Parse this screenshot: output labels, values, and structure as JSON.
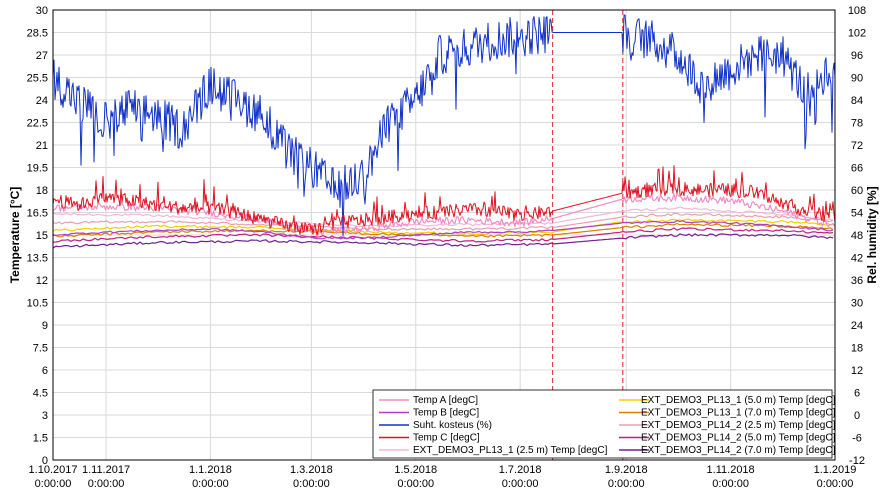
{
  "chart_data": {
    "type": "line",
    "ylabel": "Temperature [°C]",
    "y2label": "Rel. humidity [%]",
    "ylim": [
      0,
      30
    ],
    "y2lim": [
      -12,
      108
    ],
    "xlim": [
      "2017-10-01",
      "2019-01-01"
    ],
    "grid": true,
    "legend_position": "bottom-right",
    "y_ticks": [
      "0",
      "1.5",
      "3",
      "4.5",
      "6",
      "7.5",
      "9",
      "10.5",
      "12",
      "13.5",
      "15",
      "16.5",
      "18",
      "19.5",
      "21",
      "22.5",
      "24",
      "25.5",
      "27",
      "28.5",
      "30"
    ],
    "y2_ticks": [
      "-12",
      "-6",
      "0",
      "6",
      "12",
      "18",
      "24",
      "30",
      "36",
      "42",
      "48",
      "54",
      "60",
      "66",
      "72",
      "78",
      "84",
      "90",
      "96",
      "102",
      "108"
    ],
    "x_ticks": [
      {
        "date": "1.10.2017",
        "time": "0:00:00"
      },
      {
        "date": "1.11.2017",
        "time": "0:00:00"
      },
      {
        "date": "1.1.2018",
        "time": "0:00:00"
      },
      {
        "date": "1.3.2018",
        "time": "0:00:00"
      },
      {
        "date": "1.5.2018",
        "time": "0:00:00"
      },
      {
        "date": "1.7.2018",
        "time": "0:00:00"
      },
      {
        "date": "1.9.2018",
        "time": "0:00:00"
      },
      {
        "date": "1.11.2018",
        "time": "0:00:00"
      },
      {
        "date": "1.1.2019",
        "time": "0:00:00"
      }
    ],
    "markers": [
      "2018-07-20",
      "2018-08-30"
    ],
    "series": [
      {
        "name": "Temp A [degC]",
        "axis": "left",
        "color": "#f08cc4",
        "x": [
          "2017-10-01",
          "2017-11-01",
          "2017-12-01",
          "2018-01-01",
          "2018-02-01",
          "2018-03-01",
          "2018-04-01",
          "2018-05-01",
          "2018-06-01",
          "2018-07-01",
          "2018-07-20",
          "2018-08-30",
          "2018-10-01",
          "2018-11-01",
          "2018-12-01",
          "2019-01-01"
        ],
        "y": [
          16.8,
          16.9,
          16.8,
          16.5,
          16.0,
          15.2,
          15.4,
          15.9,
          16.0,
          15.8,
          16.1,
          17.4,
          17.5,
          17.3,
          16.6,
          15.6
        ]
      },
      {
        "name": "Temp B [degC]",
        "axis": "left",
        "color": "#b040c0",
        "x": [
          "2017-10-01",
          "2017-11-01",
          "2017-12-01",
          "2018-01-01",
          "2018-02-01",
          "2018-03-01",
          "2018-04-01",
          "2018-05-01",
          "2018-06-01",
          "2018-07-01",
          "2018-07-20",
          "2018-08-30",
          "2018-10-01",
          "2018-11-01",
          "2018-12-01",
          "2019-01-01"
        ],
        "y": [
          15.0,
          15.2,
          15.3,
          15.4,
          15.2,
          14.8,
          14.8,
          15.0,
          15.2,
          15.2,
          15.3,
          15.8,
          15.9,
          15.8,
          15.6,
          15.3
        ]
      },
      {
        "name": "Suht. kosteus (%)",
        "axis": "right",
        "color": "#1030c8",
        "x": [
          "2017-10-01",
          "2017-10-15",
          "2017-11-01",
          "2017-11-15",
          "2017-12-01",
          "2017-12-15",
          "2018-01-01",
          "2018-01-15",
          "2018-02-01",
          "2018-02-15",
          "2018-03-01",
          "2018-03-15",
          "2018-04-01",
          "2018-04-15",
          "2018-05-01",
          "2018-05-15",
          "2018-06-01",
          "2018-06-15",
          "2018-07-01",
          "2018-07-20",
          "2018-08-30",
          "2018-09-15",
          "2018-10-01",
          "2018-10-15",
          "2018-11-01",
          "2018-11-15",
          "2018-12-01",
          "2018-12-15",
          "2019-01-01"
        ],
        "y": [
          90,
          84,
          78,
          82,
          80,
          76,
          88,
          84,
          80,
          70,
          66,
          60,
          64,
          78,
          84,
          96,
          98,
          100,
          101,
          102,
          102,
          100,
          96,
          88,
          92,
          96,
          96,
          86,
          94
        ]
      },
      {
        "name": "Temp C [degC]",
        "axis": "left",
        "color": "#e01020",
        "x": [
          "2017-10-01",
          "2017-10-15",
          "2017-11-01",
          "2017-11-15",
          "2017-12-01",
          "2017-12-15",
          "2018-01-01",
          "2018-01-15",
          "2018-02-01",
          "2018-02-15",
          "2018-03-01",
          "2018-03-15",
          "2018-04-01",
          "2018-04-15",
          "2018-05-01",
          "2018-05-15",
          "2018-06-01",
          "2018-06-15",
          "2018-07-01",
          "2018-07-20",
          "2018-08-30",
          "2018-09-15",
          "2018-10-01",
          "2018-10-15",
          "2018-11-01",
          "2018-11-15",
          "2018-12-01",
          "2018-12-15",
          "2019-01-01"
        ],
        "y": [
          17.4,
          17.0,
          17.5,
          17.3,
          17.0,
          16.8,
          16.8,
          16.5,
          16.0,
          15.6,
          15.3,
          15.8,
          16.0,
          16.2,
          16.4,
          16.5,
          16.7,
          16.6,
          16.3,
          16.6,
          17.8,
          18.0,
          18.1,
          18.0,
          18.0,
          17.8,
          17.2,
          16.6,
          16.2
        ]
      },
      {
        "name": "EXT_DEMO3_PL13_1 (2.5 m) Temp [degC]",
        "axis": "left",
        "color": "#f0b8d8",
        "x": [
          "2017-10-01",
          "2017-12-01",
          "2018-02-01",
          "2018-04-01",
          "2018-06-01",
          "2018-07-20",
          "2018-08-30",
          "2018-10-01",
          "2018-12-01",
          "2019-01-01"
        ],
        "y": [
          16.4,
          16.3,
          15.9,
          15.6,
          15.7,
          15.8,
          16.6,
          16.8,
          16.4,
          16.0
        ]
      },
      {
        "name": "EXT_DEMO3_PL13_1 (5.0 m) Temp [degC]",
        "axis": "left",
        "color": "#f0d000",
        "x": [
          "2017-10-01",
          "2017-12-01",
          "2018-02-01",
          "2018-04-01",
          "2018-06-01",
          "2018-07-20",
          "2018-08-30",
          "2018-10-01",
          "2018-12-01",
          "2019-01-01"
        ],
        "y": [
          15.3,
          15.6,
          15.5,
          15.2,
          15.1,
          15.2,
          15.9,
          16.0,
          15.9,
          15.7
        ]
      },
      {
        "name": "EXT_DEMO3_PL13_1 (7.0 m) Temp [degC]",
        "axis": "left",
        "color": "#d88000",
        "x": [
          "2017-10-01",
          "2017-12-01",
          "2018-02-01",
          "2018-04-01",
          "2018-06-01",
          "2018-07-20",
          "2018-08-30",
          "2018-10-01",
          "2018-12-01",
          "2019-01-01"
        ],
        "y": [
          14.9,
          15.2,
          15.3,
          15.1,
          14.9,
          15.0,
          15.5,
          15.7,
          15.6,
          15.4
        ]
      },
      {
        "name": "EXT_DEMO3_PL14_2 (2.5 m) Temp [degC]",
        "axis": "left",
        "color": "#e8a0b0",
        "x": [
          "2017-10-01",
          "2017-12-01",
          "2018-02-01",
          "2018-04-01",
          "2018-06-01",
          "2018-07-20",
          "2018-08-30",
          "2018-10-01",
          "2018-12-01",
          "2019-01-01"
        ],
        "y": [
          15.8,
          15.9,
          15.7,
          15.4,
          15.4,
          15.5,
          16.2,
          16.4,
          16.2,
          15.9
        ]
      },
      {
        "name": "EXT_DEMO3_PL14_2 (5.0 m) Temp [degC]",
        "axis": "left",
        "color": "#c02080",
        "x": [
          "2017-10-01",
          "2017-12-01",
          "2018-02-01",
          "2018-04-01",
          "2018-06-01",
          "2018-07-20",
          "2018-08-30",
          "2018-10-01",
          "2018-12-01",
          "2019-01-01"
        ],
        "y": [
          14.6,
          14.9,
          15.0,
          14.8,
          14.6,
          14.7,
          15.2,
          15.4,
          15.3,
          15.1
        ]
      },
      {
        "name": "EXT_DEMO3_PL14_2 (7.0 m) Temp [degC]",
        "axis": "left",
        "color": "#702090",
        "x": [
          "2017-10-01",
          "2017-12-01",
          "2018-02-01",
          "2018-04-01",
          "2018-06-01",
          "2018-07-20",
          "2018-08-30",
          "2018-10-01",
          "2018-12-01",
          "2019-01-01"
        ],
        "y": [
          14.2,
          14.5,
          14.6,
          14.5,
          14.3,
          14.4,
          14.8,
          15.0,
          15.0,
          14.8
        ]
      }
    ]
  }
}
